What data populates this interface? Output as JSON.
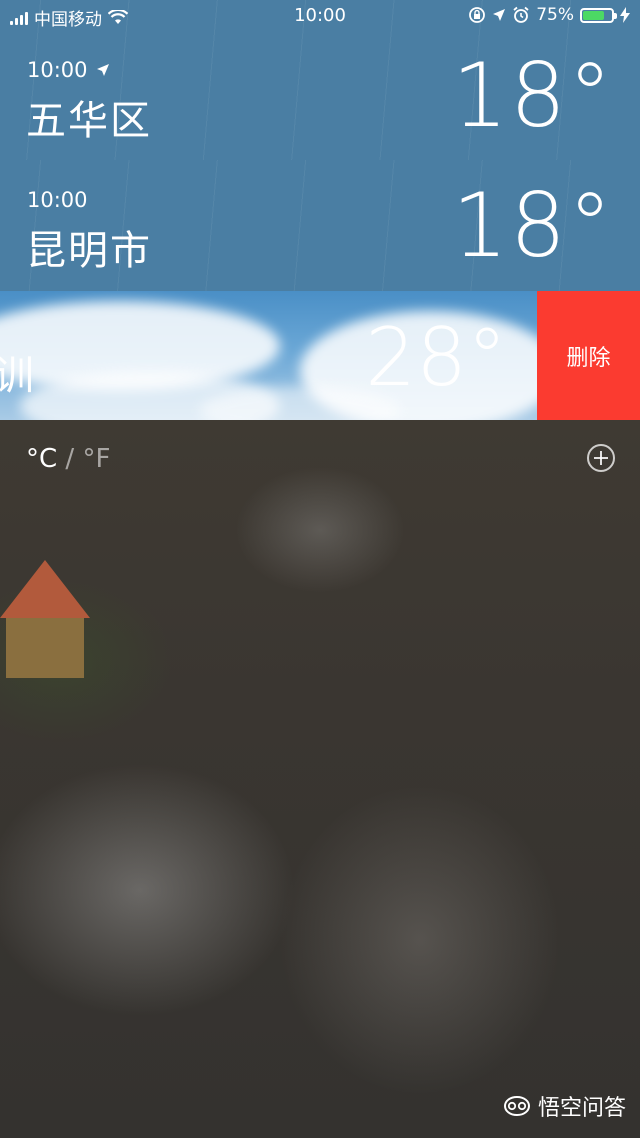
{
  "status_bar": {
    "carrier": "中国移动",
    "time": "10:00",
    "battery": "75%",
    "battery_level": 0.75,
    "icons": [
      "signal-icon",
      "wifi-icon",
      "orientation-lock-icon",
      "location-icon",
      "alarm-icon",
      "battery-icon",
      "charging-icon"
    ]
  },
  "cities": [
    {
      "time": "10:00",
      "name": "五华区",
      "temp": "18°",
      "has_location_icon": true
    },
    {
      "time": "10:00",
      "name": "昆明市",
      "temp": "18°",
      "has_location_icon": false
    }
  ],
  "swiped_row": {
    "partial_text": "训",
    "temp": "28°",
    "delete_label": "删除",
    "delete_color": "#fb3b30"
  },
  "footer": {
    "unit_c": "°C",
    "unit_sep": "/",
    "unit_f": "°F"
  },
  "watermark": {
    "text": "悟空问答"
  }
}
